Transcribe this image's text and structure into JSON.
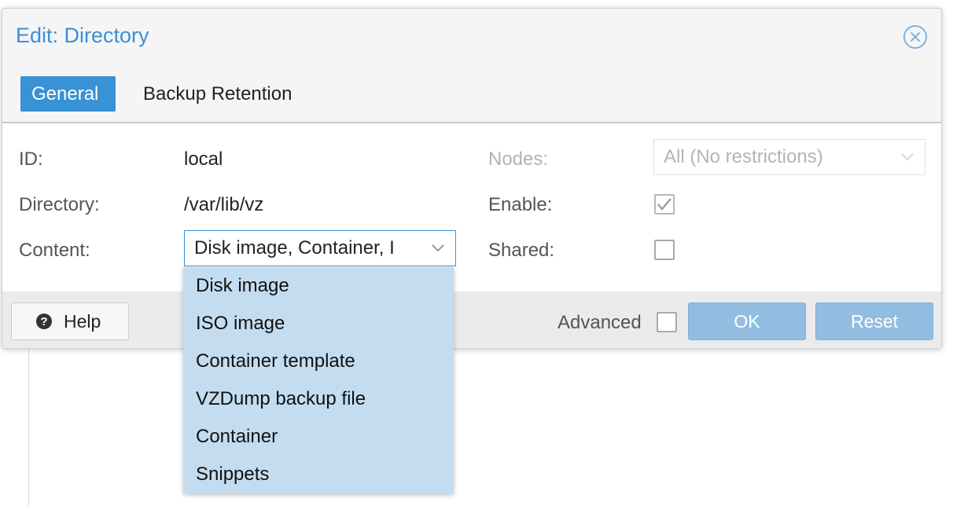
{
  "dialog": {
    "title": "Edit: Directory",
    "accent": "#3892d4"
  },
  "tabs": [
    {
      "label": "General",
      "active": true
    },
    {
      "label": "Backup Retention",
      "active": false
    }
  ],
  "form": {
    "id": {
      "label": "ID:",
      "value": "local"
    },
    "directory": {
      "label": "Directory:",
      "value": "/var/lib/vz"
    },
    "content": {
      "label": "Content:",
      "value": "Disk image, Container, I"
    },
    "nodes": {
      "label": "Nodes:",
      "value": "All (No restrictions)"
    },
    "enable": {
      "label": "Enable:",
      "checked": true
    },
    "shared": {
      "label": "Shared:",
      "checked": false
    }
  },
  "dropdown": {
    "items": [
      "Disk image",
      "ISO image",
      "Container template",
      "VZDump backup file",
      "Container",
      "Snippets"
    ]
  },
  "footer": {
    "help_label": "Help",
    "advanced_label": "Advanced",
    "advanced_checked": false,
    "ok_label": "OK",
    "reset_label": "Reset"
  }
}
